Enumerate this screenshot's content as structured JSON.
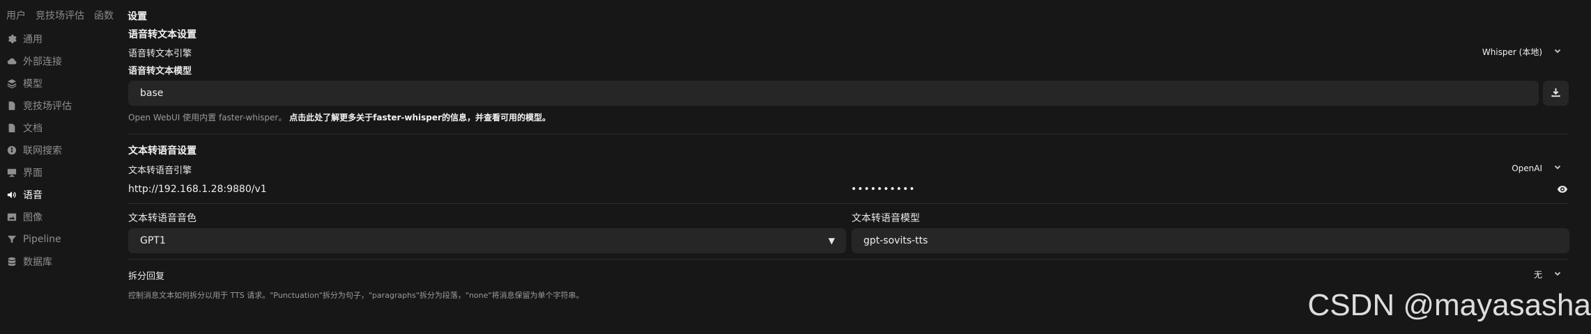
{
  "topnav": {
    "tabs": [
      "用户",
      "竞技场评估",
      "函数"
    ]
  },
  "sidebar": {
    "items": [
      {
        "label": "通用",
        "icon": "gear-icon"
      },
      {
        "label": "外部连接",
        "icon": "cloud-icon"
      },
      {
        "label": "模型",
        "icon": "stack-icon"
      },
      {
        "label": "竞技场评估",
        "icon": "document-icon"
      },
      {
        "label": "文档",
        "icon": "document-icon"
      },
      {
        "label": "联网搜索",
        "icon": "globe-icon"
      },
      {
        "label": "界面",
        "icon": "monitor-icon"
      },
      {
        "label": "语音",
        "icon": "speaker-icon"
      },
      {
        "label": "图像",
        "icon": "image-icon"
      },
      {
        "label": "Pipeline",
        "icon": "funnel-icon"
      },
      {
        "label": "数据库",
        "icon": "database-icon"
      }
    ],
    "active": "语音"
  },
  "main": {
    "title": "设置",
    "stt": {
      "section_title": "语音转文本设置",
      "engine_label": "语音转文本引擎",
      "engine_value": "Whisper (本地)",
      "model_label": "语音转文本模型",
      "model_value": "base",
      "hint_prefix": "Open WebUI 使用内置 faster-whisper。",
      "hint_link": "点击此处了解更多关于faster-whisper的信息，并查看可用的模型。"
    },
    "tts": {
      "section_title": "文本转语音设置",
      "engine_label": "文本转语音引擎",
      "engine_value": "OpenAI",
      "api_url": "http://192.168.1.28:9880/v1",
      "api_key_masked": "••••••••••",
      "voice_label": "文本转语音音色",
      "voice_value": "GPT1",
      "model_label": "文本转语音模型",
      "model_value": "gpt-sovits-tts"
    },
    "split": {
      "label": "拆分回复",
      "value": "无",
      "hint": "控制消息文本如何拆分以用于 TTS 请求。\"Punctuation\"拆分为句子，\"paragraphs\"拆分为段落，\"none\"将消息保留为单个字符串。"
    }
  },
  "watermark": "CSDN @mayasasha"
}
